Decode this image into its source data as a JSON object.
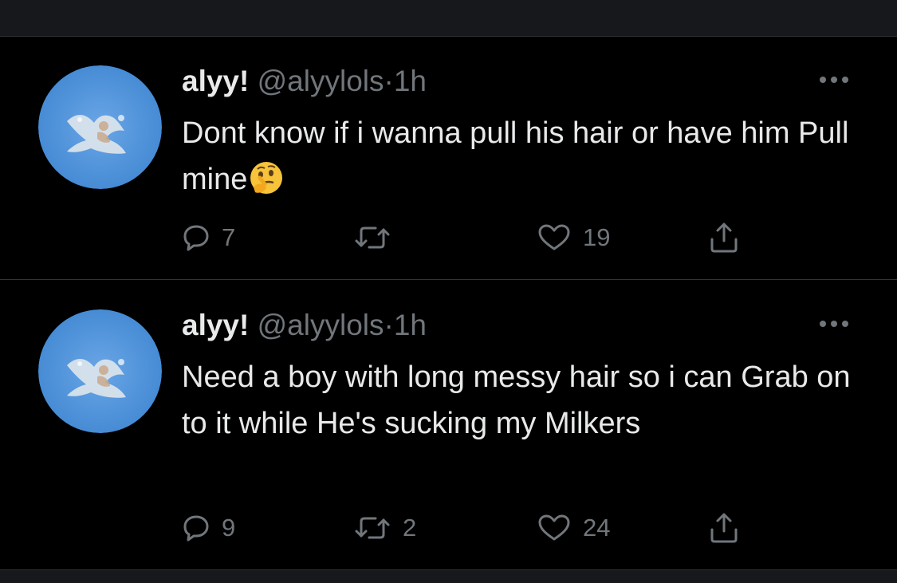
{
  "tweets": [
    {
      "name": "alyy!",
      "handle": "@alyylols",
      "dot": "·",
      "time": "1h",
      "text": "Dont know if i wanna pull his hair or have him Pull mine",
      "emoji": "thinking-face",
      "replies": "7",
      "retweets": "",
      "likes": "19"
    },
    {
      "name": "alyy!",
      "handle": "@alyylols",
      "dot": "·",
      "time": "1h",
      "text": "Need a boy with long messy hair so i can Grab on to it while He's sucking my Milkers",
      "replies": "9",
      "retweets": "2",
      "likes": "24"
    }
  ],
  "colors": {
    "background": "#000000",
    "text": "#e7e9ea",
    "secondary": "#71767b",
    "divider": "#2f3336",
    "avatar_blue": "#4a8ed6"
  },
  "icons": [
    "reply-icon",
    "retweet-icon",
    "like-icon",
    "share-icon",
    "more-icon"
  ]
}
